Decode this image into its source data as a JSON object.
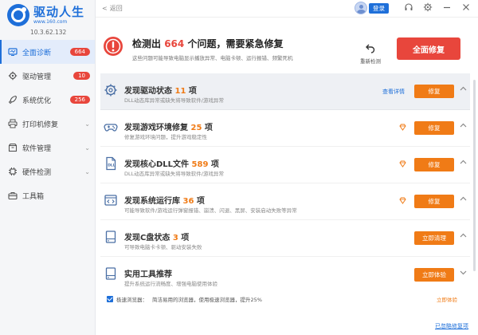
{
  "app": {
    "brand_title": "驱动人生",
    "brand_url": "www.160.com",
    "version": "10.3.62.132"
  },
  "sidebar": {
    "items": [
      {
        "label": "全面诊断",
        "badge": "664",
        "icon": "monitor-icon",
        "active": true
      },
      {
        "label": "驱动管理",
        "badge": "10",
        "icon": "gear-icon"
      },
      {
        "label": "系统优化",
        "badge": "256",
        "icon": "rocket-icon"
      },
      {
        "label": "打印机修复",
        "chevron": "⌄",
        "icon": "printer-icon"
      },
      {
        "label": "软件管理",
        "chevron": "⌄",
        "icon": "package-icon"
      },
      {
        "label": "硬件检测",
        "chevron": "⌄",
        "icon": "chip-icon"
      },
      {
        "label": "工具箱",
        "icon": "toolbox-icon"
      }
    ]
  },
  "topbar": {
    "back_label": "返回",
    "login_label": "登录"
  },
  "alert": {
    "title_prefix": "检测出",
    "count": "664",
    "title_suffix": "个问题，需要紧急修复",
    "subtitle": "这些问题可能导致电脑显示播放异常、电脑卡顿、运行报错、频繁死机",
    "redetect_label": "重新检测",
    "repair_all_label": "全面修复"
  },
  "items": [
    {
      "title_prefix": "发现驱动状态",
      "count": "11",
      "title_suffix": "项",
      "desc": "DLL动态库异常或缺失将导致软件/游戏异常",
      "button": "修复",
      "link": "查看详情",
      "icon": "gear-icon"
    },
    {
      "title_prefix": "发现游戏环境修复",
      "count": "25",
      "title_suffix": "项",
      "desc": "修复游戏环境问题，提升游戏稳定性",
      "button": "修复",
      "icon": "gamepad-icon"
    },
    {
      "title_prefix": "发现核心DLL文件",
      "count": "589",
      "title_suffix": "项",
      "desc": "DLL动态库异常或缺失将导致软件/游戏异常",
      "button": "修复",
      "icon": "dll-file-icon"
    },
    {
      "title_prefix": "发现系统运行库",
      "count": "36",
      "title_suffix": "项",
      "desc": "可能导致软件/游戏运行弹窗报错、崩溃、闪退、黑屏、安装启动失败等异常",
      "button": "修复",
      "icon": "code-window-icon"
    },
    {
      "title_prefix": "发现C盘状态",
      "count": "3",
      "title_suffix": "项",
      "desc": "可导致电脑卡卡顿、驱动安装失败",
      "button": "立即清理",
      "icon": "disk-icon"
    },
    {
      "title_prefix": "实用工具推荐",
      "count": "",
      "title_suffix": "",
      "desc": "提升系统运行流畅度、增强电脑使用体验",
      "button": "立即体验",
      "icon": "disk-icon"
    }
  ],
  "browser": {
    "name": "极速浏览器：",
    "desc": "简洁易用的浏览器，使用极速浏览器，提升25%",
    "link": "立即体验"
  },
  "footer": {
    "ignored_link": "已忽略修复项"
  },
  "colors": {
    "accent": "#1e6fd9",
    "danger": "#e8463c",
    "orange": "#f07b16"
  }
}
